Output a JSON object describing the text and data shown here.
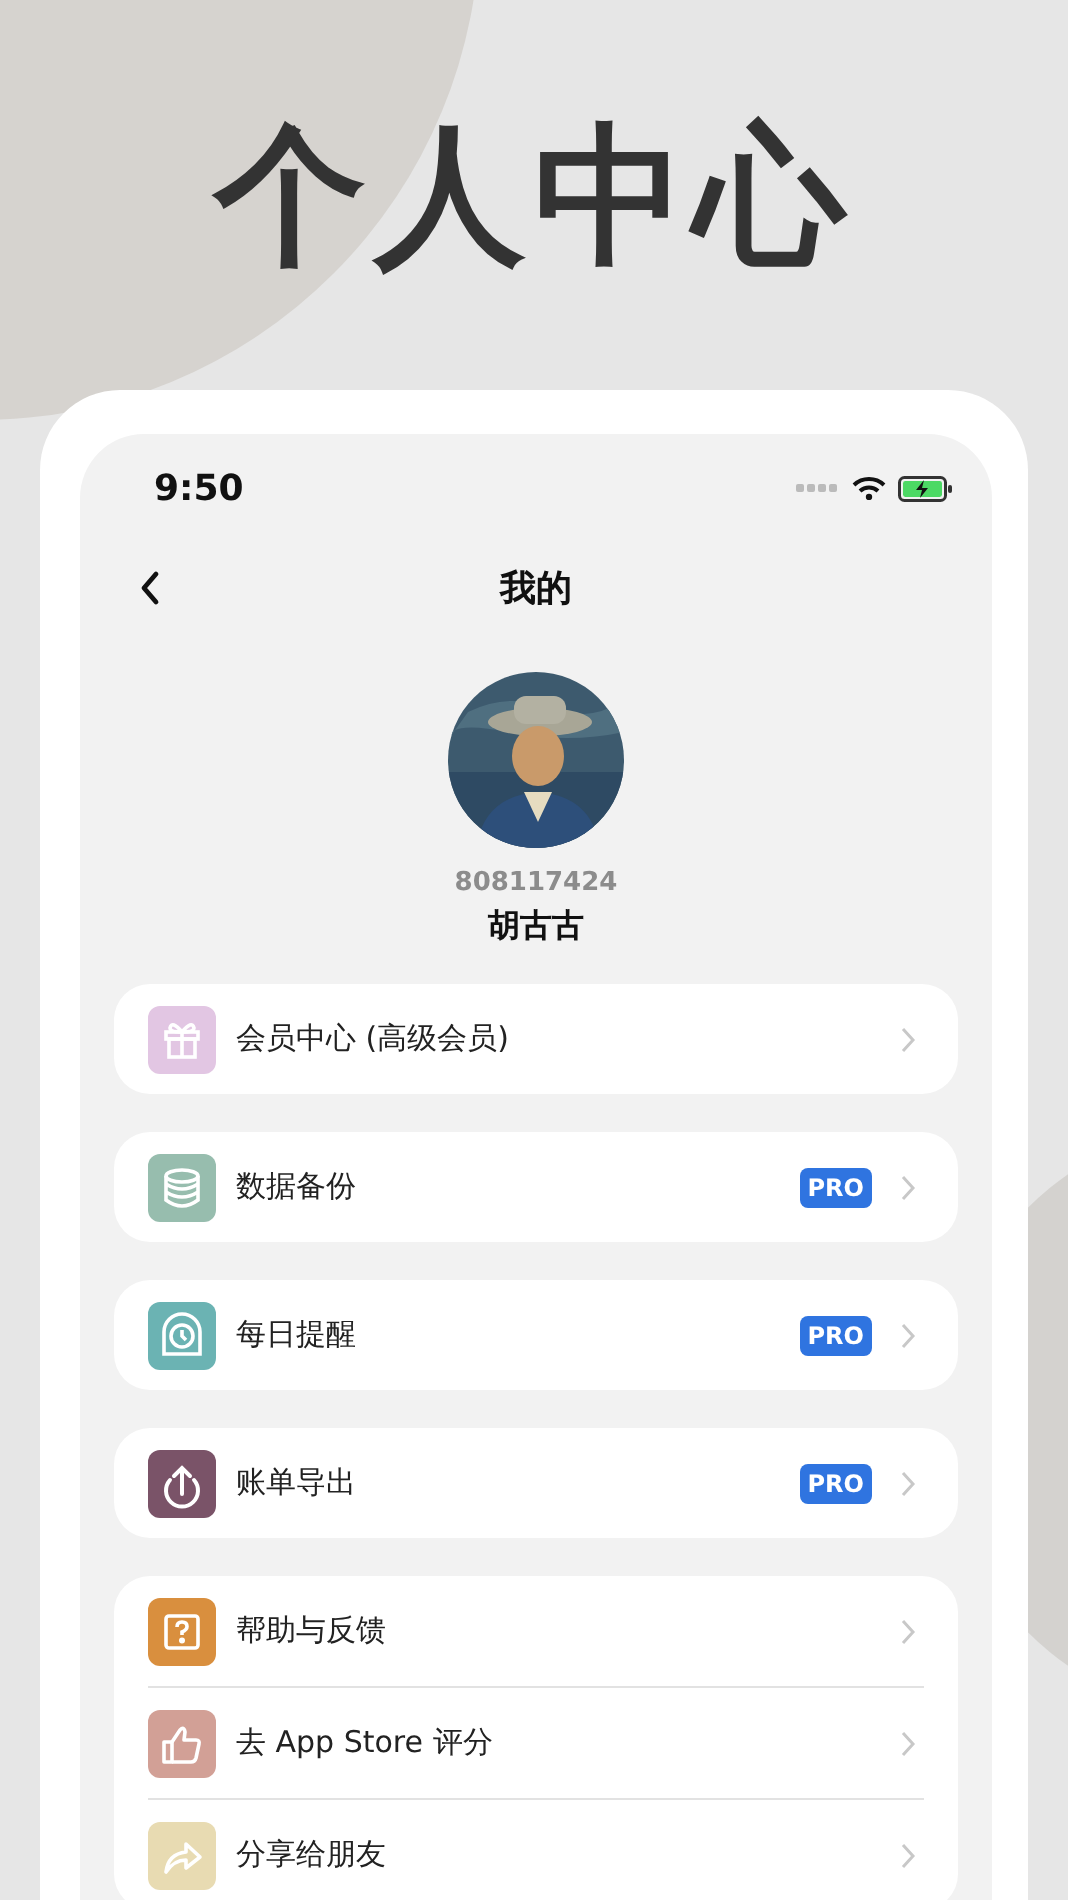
{
  "headline": "个人中心",
  "status_bar": {
    "time": "9:50"
  },
  "nav": {
    "title": "我的"
  },
  "profile": {
    "id": "808117424",
    "name": "胡古古"
  },
  "groups": [
    {
      "items": [
        {
          "kind": "gift",
          "color": "#e2c6e3",
          "label": "会员中心 (高级会员)"
        }
      ]
    },
    {
      "items": [
        {
          "kind": "database",
          "color": "#97bdae",
          "label": "数据备份",
          "badge": "PRO"
        }
      ]
    },
    {
      "items": [
        {
          "kind": "clock",
          "color": "#6bb3b3",
          "label": "每日提醒",
          "badge": "PRO"
        }
      ]
    },
    {
      "items": [
        {
          "kind": "upload",
          "color": "#7a5368",
          "label": "账单导出",
          "badge": "PRO"
        }
      ]
    },
    {
      "items": [
        {
          "kind": "question",
          "color": "#d98f3e",
          "label": "帮助与反馈"
        },
        {
          "kind": "thumb",
          "color": "#d2a096",
          "label": "去 App Store 评分"
        },
        {
          "kind": "share",
          "color": "#e8dbb2",
          "label": "分享给朋友"
        }
      ]
    }
  ]
}
